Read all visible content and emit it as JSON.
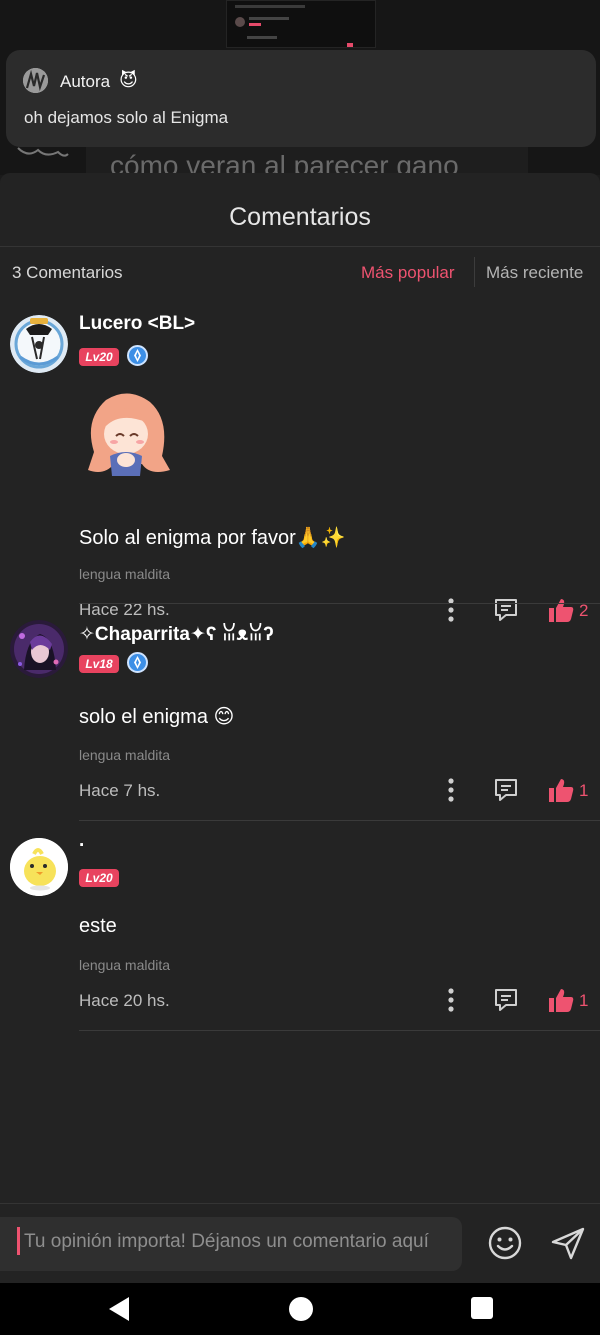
{
  "toast": {
    "author": "Autora",
    "emoji": "😈",
    "message": "oh dejamos solo al Enigma"
  },
  "background": {
    "story_text": "cómo veran al parecer gano"
  },
  "sheet": {
    "title": "Comentarios",
    "count_label": "3 Comentarios",
    "sort_popular": "Más popular",
    "sort_recent": "Más reciente",
    "accent_color": "#ee5370"
  },
  "comments": [
    {
      "author": "Lucero <BL>",
      "level": "Lv20",
      "verified": true,
      "has_sticker": true,
      "text": "Solo al enigma por favor🙏✨",
      "topic": "lengua maldita",
      "time": "Hace 22 hs.",
      "likes": "2"
    },
    {
      "author": "✧Chaparrita✦ʕ ꈍᴥꈍʔ",
      "level": "Lv18",
      "verified": true,
      "has_sticker": false,
      "text": "solo el enigma 😊",
      "topic": "lengua maldita",
      "time": "Hace 7 hs.",
      "likes": "1"
    },
    {
      "author": ".",
      "level": "Lv20",
      "verified": false,
      "has_sticker": false,
      "text": "este",
      "topic": "lengua maldita",
      "time": "Hace 20 hs.",
      "likes": "1"
    }
  ],
  "input": {
    "placeholder": "Tu opinión importa! Déjanos un comentario aquí"
  },
  "icons": {
    "more": "more-vertical-icon",
    "reply": "reply-icon",
    "like": "thumbs-up-icon",
    "emoji": "smiley-icon",
    "send": "send-icon"
  }
}
